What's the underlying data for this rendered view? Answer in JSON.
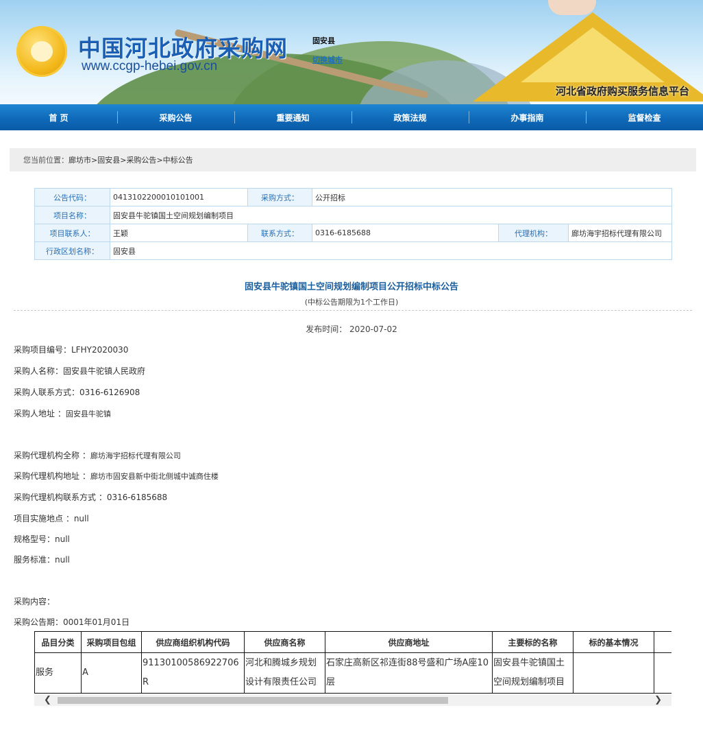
{
  "header": {
    "site_title": "中国河北政府采购网",
    "site_url": "www.ccgp-hebei.gov.cn",
    "region": "固安县",
    "switch_city": "切换城市",
    "platform_name": "河北省政府购买服务信息平台"
  },
  "nav": {
    "items": [
      {
        "label": "首 页"
      },
      {
        "label": "采购公告"
      },
      {
        "label": "重要通知"
      },
      {
        "label": "政策法规"
      },
      {
        "label": "办事指南"
      },
      {
        "label": "监督检查"
      }
    ]
  },
  "breadcrumb": {
    "label": "您当前位置：",
    "items": [
      "廊坊市",
      "固安县",
      "采购公告",
      "中标公告"
    ],
    "separator": ">"
  },
  "info": {
    "code_label": "公告代码：",
    "code": "0413102200010101001",
    "method_label": "采购方式：",
    "method": "公开招标",
    "project_label": "项目名称：",
    "project": "固安县牛驼镇国土空间规划编制项目",
    "contact_label": "项目联系人：",
    "contact": "王颖",
    "phone_label": "联系方式：",
    "phone": "0316-6185688",
    "agency_label": "代理机构：",
    "agency": "廊坊海宇招标代理有限公司",
    "district_label": "行政区划名称：",
    "district": "固安县"
  },
  "notice": {
    "title": "固安县牛驼镇国土空间规划编制项目公开招标中标公告",
    "subtitle": "(中标公告期限为1个工作日)",
    "publish_label": "发布时间：",
    "publish_date": "2020-07-02"
  },
  "fields": {
    "project_no": "采购项目编号：LFHY2020030",
    "buyer_name": "采购人名称：固安县牛驼镇人民政府",
    "buyer_phone": "采购人联系方式：0316-6126908",
    "buyer_address_label": "采购人地址 ：",
    "buyer_address": "固安县牛驼镇",
    "agency_name_label": "采购代理机构全称 ：",
    "agency_name": "廊坊海宇招标代理有限公司",
    "agency_address_label": "采购代理机构地址 ：",
    "agency_address": "廊坊市固安县新中街北侧城中诚商住楼",
    "agency_phone": "采购代理机构联系方式 ：0316-6185688",
    "location": "项目实施地点 ：null",
    "spec": "规格型号：null",
    "standard": "服务标准：null",
    "content": "采购内容：",
    "period": "采购公告期：0001年01月01日"
  },
  "result_table": {
    "headers": [
      "品目分类",
      "采购项目包组",
      "供应商组织机构代码",
      "供应商名称",
      "供应商地址",
      "主要标的名称",
      "标的基本情况"
    ],
    "row": [
      "服务",
      "A",
      "91130100586922706R",
      "河北和腾城乡规划设计有限责任公司",
      "石家庄高新区祁连街88号盛和广场A座10层",
      "固安县牛驼镇国土空间规划编制项目",
      ""
    ]
  },
  "colors": {
    "nav_bg": "#0f6ab9",
    "title_blue": "#1b5e9b",
    "label_blue": "#2a6fb7",
    "info_label_bg": "#e9f4fc"
  },
  "icons": {
    "logo": "ccgp-emblem-icon",
    "scroll_left": "chevron-left-icon",
    "scroll_right": "chevron-right-icon"
  }
}
